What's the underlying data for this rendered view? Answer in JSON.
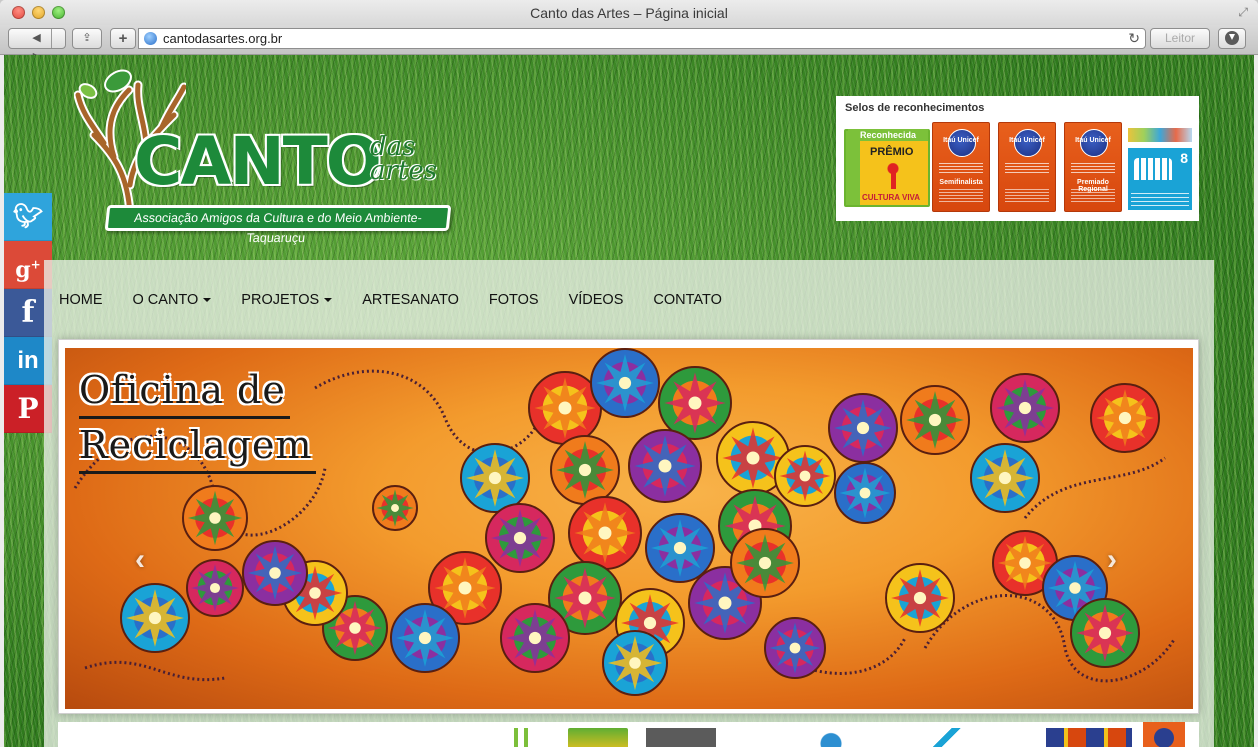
{
  "browser": {
    "window_title": "Canto das Artes – Página inicial",
    "url": "cantodasartes.org.br",
    "reader_label": "Leitor"
  },
  "logo": {
    "word": "CANTO",
    "das": "das",
    "artes": "artes",
    "ribbon": "Associação Amigos da Cultura e do Meio Ambiente-Taquaruçu"
  },
  "selos": {
    "title": "Selos de reconhecimentos",
    "seals": [
      {
        "badge": "Reconhecida",
        "side": "Iniciativa",
        "title": "PRÊMIO",
        "foot": "CULTURA VIVA"
      },
      {
        "brand": "Itaú Unicef",
        "label": "Semifinalista"
      },
      {
        "brand": "Itaú Unicef",
        "label": ""
      },
      {
        "brand": "Itaú Unicef",
        "label": "Premiado Regional"
      },
      {
        "number": "8"
      }
    ]
  },
  "social": [
    "twitter",
    "google-plus",
    "facebook",
    "linkedin",
    "pinterest"
  ],
  "menu": [
    {
      "label": "HOME",
      "dropdown": false
    },
    {
      "label": "O CANTO",
      "dropdown": true
    },
    {
      "label": "PROJETOS",
      "dropdown": true
    },
    {
      "label": "ARTESANATO",
      "dropdown": false
    },
    {
      "label": "FOTOS",
      "dropdown": false
    },
    {
      "label": "VÍDEOS",
      "dropdown": false
    },
    {
      "label": "CONTATO",
      "dropdown": false
    }
  ],
  "slider": {
    "title_line1": "Oficina de",
    "title_line2": "Reciclagem",
    "prev": "‹",
    "next": "›"
  },
  "colors": {
    "grass": "#3c8a25",
    "slide_orange": "#f39b2d",
    "twitter": "#2fa4dc",
    "gplus": "#dc4a38",
    "facebook": "#3b5998",
    "linkedin": "#1e88c8",
    "pinterest": "#cb2027"
  }
}
